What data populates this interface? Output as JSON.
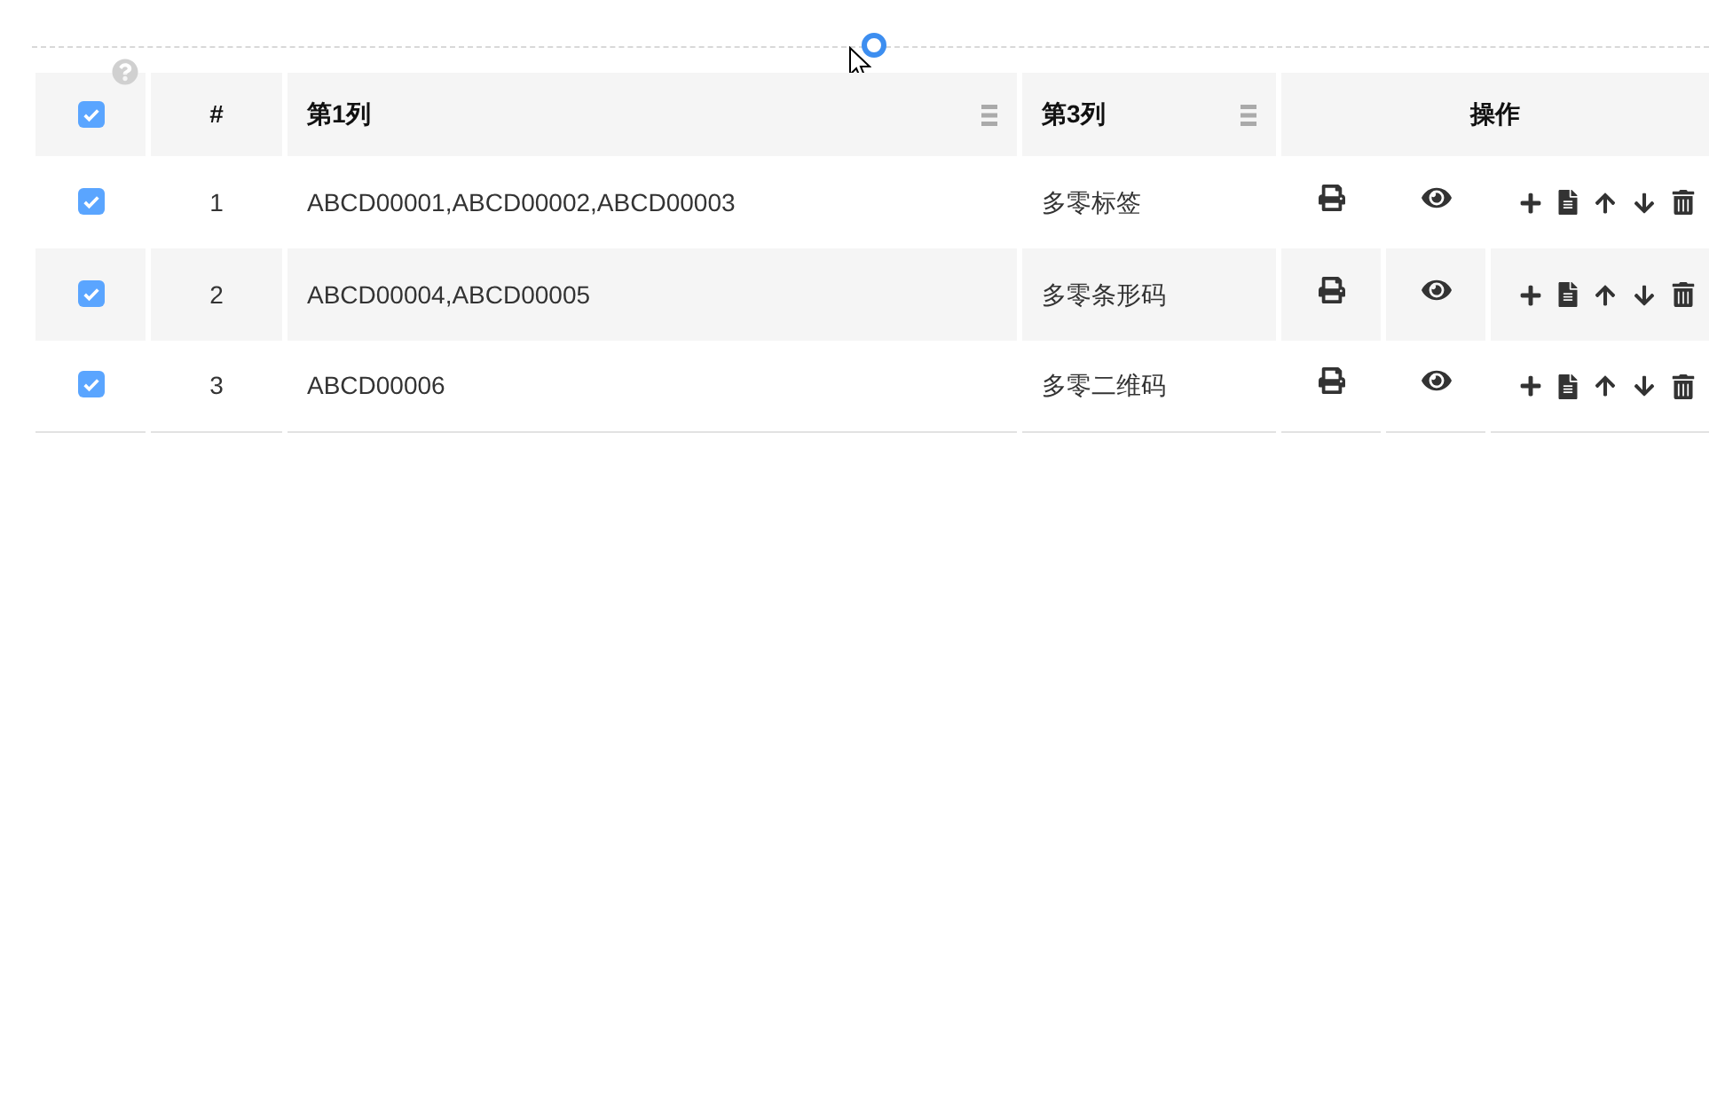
{
  "table": {
    "select_all": {
      "checked": true
    },
    "columns": [
      {
        "label": "#",
        "menu": false
      },
      {
        "label": "第1列",
        "menu": true
      },
      {
        "label": "第3列",
        "menu": true
      },
      {
        "label": "操作",
        "menu": false
      }
    ],
    "rows": [
      {
        "checked": true,
        "index": "1",
        "column_1": "ABCD00001,ABCD00002,ABCD00003",
        "column_3": "多零标签"
      },
      {
        "checked": true,
        "index": "2",
        "column_1": "ABCD00004,ABCD00005",
        "column_3": "多零条形码"
      },
      {
        "checked": true,
        "index": "3",
        "column_1": "ABCD00006",
        "column_3": "多零二维码"
      }
    ]
  }
}
